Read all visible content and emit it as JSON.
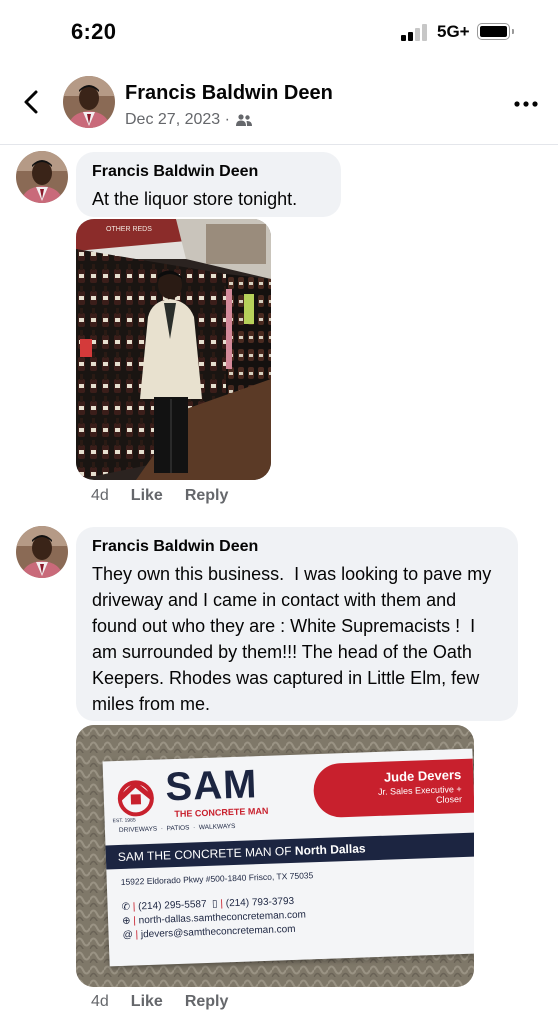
{
  "status_bar": {
    "time": "6:20",
    "network": "5G+"
  },
  "header": {
    "name": "Francis Baldwin Deen",
    "date": "Dec 27, 2023 ·",
    "privacy_icon": "friends-icon"
  },
  "comments": [
    {
      "author": "Francis Baldwin Deen",
      "text": "At the liquor store tonight.",
      "photo_sign": "OTHER REDS",
      "age": "4d",
      "like": "Like",
      "reply": "Reply"
    },
    {
      "author": "Francis Baldwin Deen",
      "text": "They own this business.  I was looking to pave my driveway and I came in contact with them and found out who they are : White Supremacists !  I am surrounded by them!!! The head of the Oath Keepers. Rhodes was captured in Little Elm, few miles from me.",
      "age": "4d",
      "like": "Like",
      "reply": "Reply"
    }
  ],
  "business_card": {
    "brand": "SAM",
    "brand_sub": "THE CONCRETE MAN",
    "est": "EST. 1985",
    "services": "DRIVEWAYS  ·  PATIOS  ·  WALKWAYS",
    "person_name": "Jude Devers",
    "person_title": "Jr. Sales Executive +",
    "person_title2": "Closer",
    "band_prefix": "SAM THE CONCRETE MAN OF ",
    "band_location": "North Dallas",
    "address": "15922 Eldorado Pkwy #500-1840  Frisco, TX 75035",
    "phone_office": "(214) 295-5587",
    "phone_mobile": "(214) 793-3793",
    "website": "north-dallas.samtheconcreteman.com",
    "email": "jdevers@samtheconcreteman.com"
  },
  "colors": {
    "accent_red": "#c8202d",
    "navy": "#1c2541",
    "meta_gray": "#65676b",
    "bubble": "#f0f2f5"
  }
}
